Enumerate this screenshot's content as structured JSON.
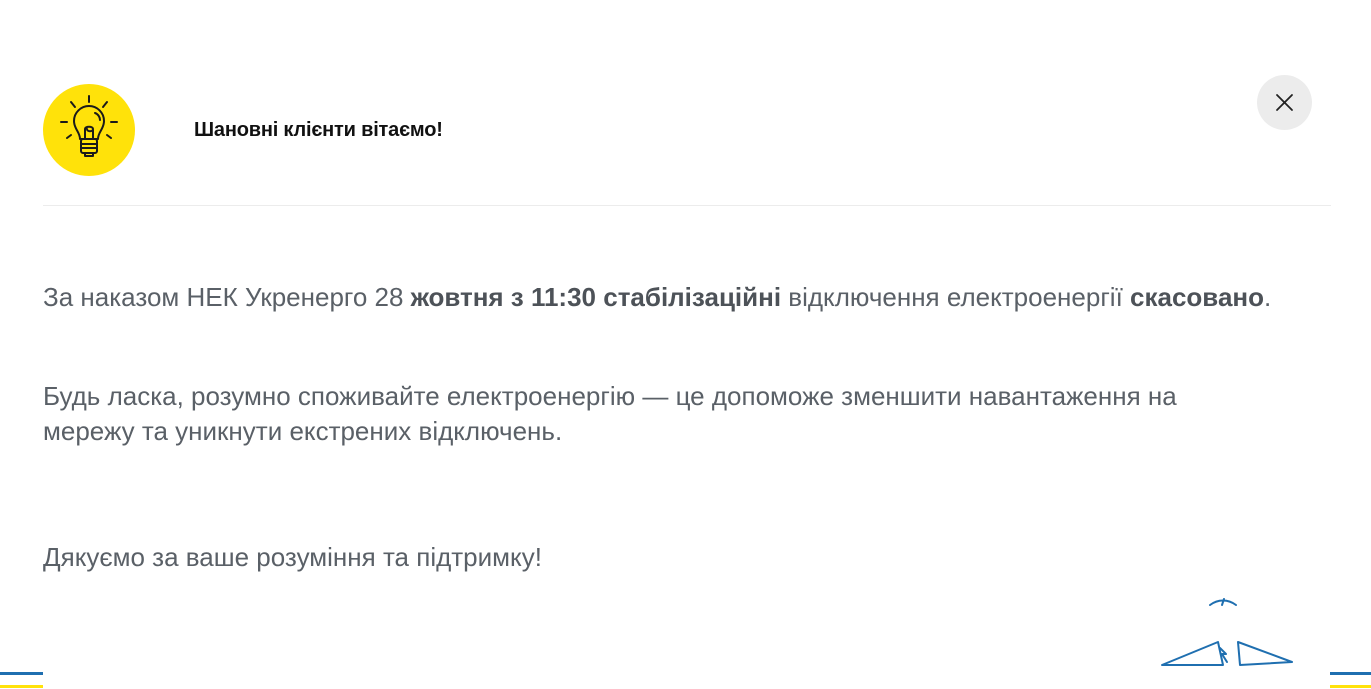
{
  "header": {
    "title": "Шановні клієнти вітаємо!"
  },
  "icons": {
    "bulb": "lightbulb-icon",
    "close": "close-icon"
  },
  "message": {
    "p1": {
      "t1": "За наказом НЕК Укренерго 28 ",
      "b1": "жовтня з 11:30 стабілізаційні",
      "t2": " відключення електроенергії ",
      "b2": "скасовано",
      "t3": "."
    },
    "p2": "Будь ласка, розумно споживайте електроенергію — це допоможе зменшити навантаження на мережу та уникнути екстрених відключень.",
    "p3": "Дякуємо за ваше розуміння та підтримку!"
  },
  "colors": {
    "accent_yellow": "#ffe20a",
    "accent_blue": "#1f6fb0",
    "text": "#5a6067"
  }
}
